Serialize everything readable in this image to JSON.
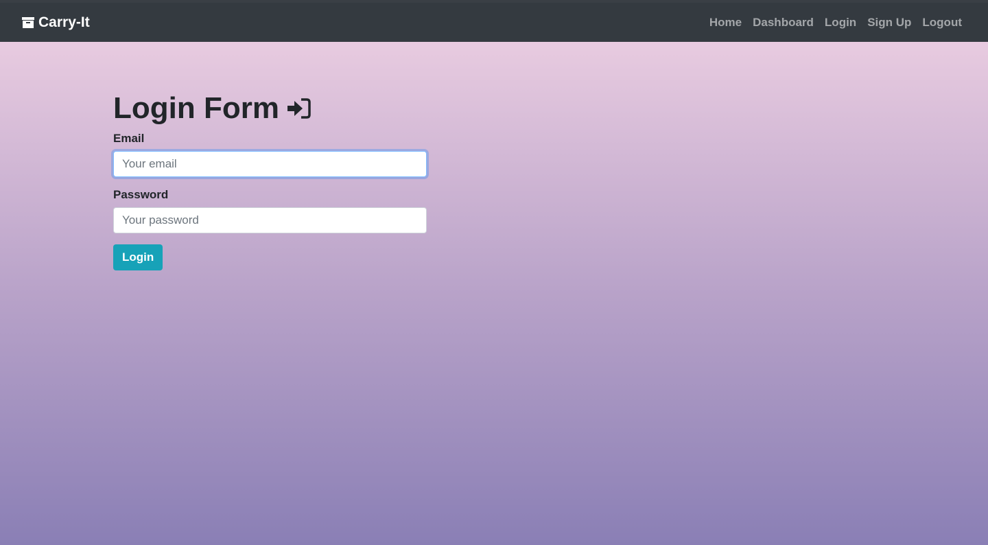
{
  "navbar": {
    "brand": "Carry-It",
    "brand_icon": "archive-box-icon",
    "links": [
      "Home",
      "Dashboard",
      "Login",
      "Sign Up",
      "Logout"
    ]
  },
  "form": {
    "title": "Login Form",
    "title_icon": "sign-in-icon",
    "email_label": "Email",
    "email_placeholder": "Your email",
    "email_value": "",
    "password_label": "Password",
    "password_placeholder": "Your password",
    "password_value": "",
    "submit_label": "Login"
  },
  "colors": {
    "navbar_bg": "#343a40",
    "button_bg": "#17a2b8",
    "focus_ring": "#80bdff",
    "gradient_top": "#e8cbe0",
    "gradient_bottom": "#8a7fb5"
  }
}
